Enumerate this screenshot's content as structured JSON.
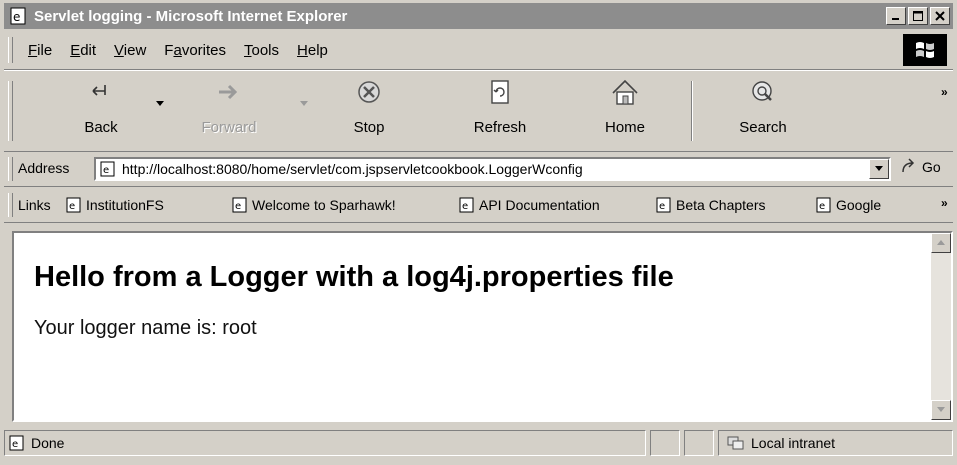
{
  "window": {
    "title": "Servlet logging - Microsoft Internet Explorer",
    "controls": [
      "minimize-icon",
      "maximize-icon",
      "close-icon"
    ]
  },
  "menu": [
    "File",
    "Edit",
    "View",
    "Favorites",
    "Tools",
    "Help"
  ],
  "menu_underline": [
    "F",
    "E",
    "V",
    "a",
    "T",
    "H"
  ],
  "toolbar": {
    "back": "Back",
    "forward": "Forward",
    "stop": "Stop",
    "refresh": "Refresh",
    "home": "Home",
    "search": "Search",
    "more": "»"
  },
  "address": {
    "label": "Address",
    "url": "http://localhost:8080/home/servlet/com.jspservletcookbook.LoggerWconfig",
    "go": "Go"
  },
  "links": {
    "label": "Links",
    "items": [
      "InstitutionFS",
      "Welcome to Sparhawk!",
      "API Documentation",
      "Beta Chapters",
      "Google"
    ],
    "more": "»"
  },
  "page": {
    "heading": "Hello from a Logger with a log4j.properties file",
    "body": "Your logger name is: root"
  },
  "status": {
    "text": "Done",
    "zone": "Local intranet"
  },
  "colors": {
    "titlebar": "#8d8d8d",
    "chrome": "#d4d0c8",
    "content_bg": "#ffffff"
  }
}
